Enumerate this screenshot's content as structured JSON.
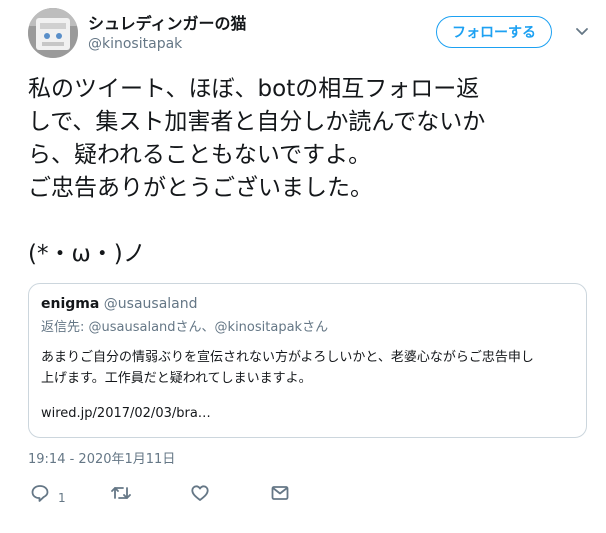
{
  "author": {
    "display_name": "シュレディンガーの猫",
    "handle": "@kinositapak",
    "follow_label": "フォローする"
  },
  "tweet": {
    "lines": [
      "私のツイート、ほぼ、botの相互フォロー返",
      "しで、集スト加害者と自分しか読んでないか",
      "ら、疑われることもないですよ。",
      "ご忠告ありがとうございました。",
      "",
      "(*・ω・)ノ"
    ],
    "timestamp": "19:14 - 2020年1月11日"
  },
  "quoted": {
    "name": "enigma",
    "handle": "@usausaland",
    "reply_to": "返信先: @usausalandさん、@kinositapakさん",
    "body_lines": [
      "あまりご自分の情弱ぶりを宣伝されない方がよろしいかと、老婆心ながらご忠告申し",
      "上げます。工作員だと疑われてしまいますよ。"
    ],
    "link": "wired.jp/2017/02/03/bra…"
  },
  "actions": {
    "reply_count": "1"
  },
  "colors": {
    "accent": "#1da1f2",
    "secondary_text": "#657786",
    "border": "#ccd6dd"
  },
  "icons": [
    "avatar-image",
    "chevron-down-icon",
    "reply-icon",
    "retweet-icon",
    "like-icon",
    "message-icon"
  ]
}
